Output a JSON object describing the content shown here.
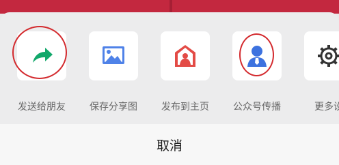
{
  "share_sheet": {
    "actions": [
      {
        "label": "发送给朋友",
        "icon": "share-arrow-icon",
        "color": "#12a86b"
      },
      {
        "label": "保存分享图",
        "icon": "image-icon",
        "color": "#4f82e8"
      },
      {
        "label": "发布到主页",
        "icon": "home-person-icon",
        "color": "#e34b46"
      },
      {
        "label": "公众号传播",
        "icon": "user-icon",
        "color": "#3d72df"
      },
      {
        "label": "更多设",
        "icon": "gear-icon",
        "color": "#333333"
      }
    ],
    "cancel_label": "取消"
  },
  "colors": {
    "banner": "#c3283f",
    "sheet_background": "#ececed",
    "cancel_background": "#f7f7f7",
    "annotation_circle": "#d3292d",
    "label": "#666666"
  }
}
